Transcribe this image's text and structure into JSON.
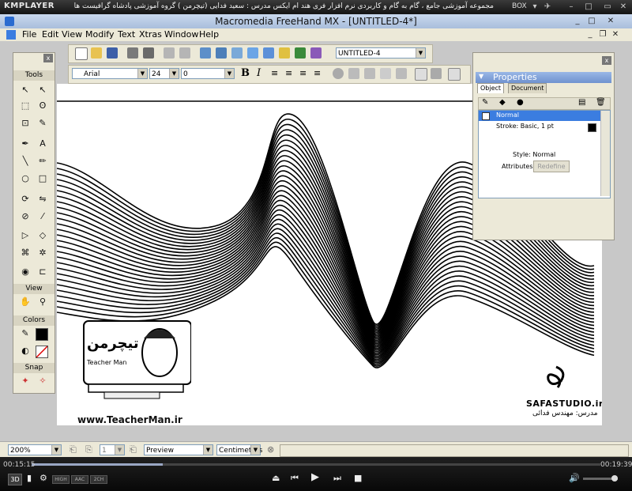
{
  "player": {
    "logo": "KMPLAYER",
    "title": "مجموعه آموزشی جامع ، گام به گام و کاربردی نرم افزار فری هند ام ایکس   مدرس : سعید فدایی (تیچرمن ) گروه آموزشی پادشاه گرافیست ها",
    "box_label": "BOX",
    "time_elapsed": "00:15:15",
    "time_total": "00:19:39",
    "progress": 0.23,
    "badges": [
      "3D",
      "HIGH",
      "AAC",
      "2CH"
    ]
  },
  "app": {
    "title": "Macromedia FreeHand MX - [UNTITLED-4*]",
    "menus": [
      "File",
      "Edit",
      "View",
      "Modify",
      "Text",
      "Xtras",
      "Window",
      "Help"
    ]
  },
  "toolbar": {
    "document_select": "UNTITLED-4",
    "font_select": "Arial",
    "size_select": "24",
    "leading_select": "0"
  },
  "tools_panel": {
    "close": "x",
    "tools_label": "Tools",
    "view_label": "View",
    "colors_label": "Colors",
    "snap_label": "Snap"
  },
  "properties": {
    "title": "Properties",
    "tabs": [
      "Object",
      "Document"
    ],
    "items": [
      {
        "label": "Normal",
        "selected": true
      },
      {
        "label": "Stroke: Basic, 1 pt",
        "selected": false
      }
    ],
    "style_text": "Style: Normal",
    "attributes_label": "Attributes:",
    "redefine_label": "Redefine",
    "close": "x"
  },
  "status": {
    "zoom": "200%",
    "page": "1",
    "view_mode": "Preview",
    "units": "Centimeters"
  },
  "watermark": {
    "brand_fa": "تیچرمن",
    "brand_en": "Teacher Man",
    "url": "www.TeacherMan.ir",
    "studio": "SAFASTUDIO.ir",
    "teacher": "مدرس: مهندس فدائی"
  },
  "colors": {
    "selection": "#3b7de0",
    "window_bg": "#ece9d8",
    "canvas": "#ffffff"
  }
}
